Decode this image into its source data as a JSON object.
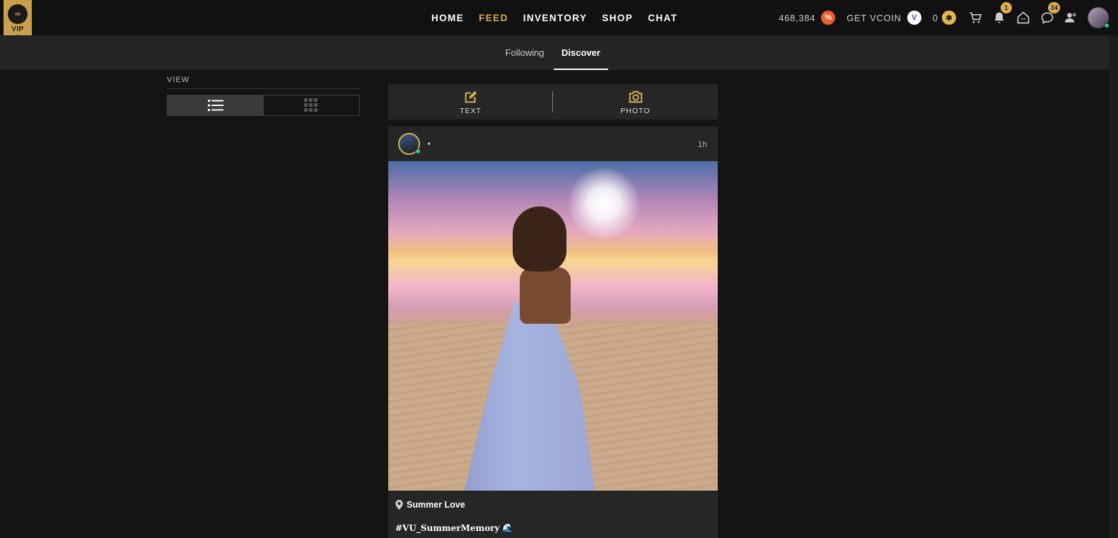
{
  "brand": {
    "vip_label": "VIP",
    "logo_text": "IMVU"
  },
  "nav": {
    "items": [
      "HOME",
      "FEED",
      "INVENTORY",
      "SHOP",
      "CHAT"
    ],
    "active": "FEED",
    "accent": "#d9ad55"
  },
  "account": {
    "credits": "468,384",
    "get_vcoin_label": "GET VCOIN",
    "vcoin": "0",
    "notifications_badge": "1",
    "messages_badge": "34"
  },
  "subnav": {
    "following_label": "Following",
    "discover_label": "Discover",
    "active": "Discover"
  },
  "view": {
    "label": "VIEW",
    "modes": [
      "list",
      "grid"
    ],
    "selected": "list"
  },
  "composer": {
    "text_label": "TEXT",
    "photo_label": "PHOTO"
  },
  "post": {
    "username": "⋆",
    "time": "1h",
    "location": "Summer Love",
    "hashtag": "#VU_SummerMemory"
  }
}
